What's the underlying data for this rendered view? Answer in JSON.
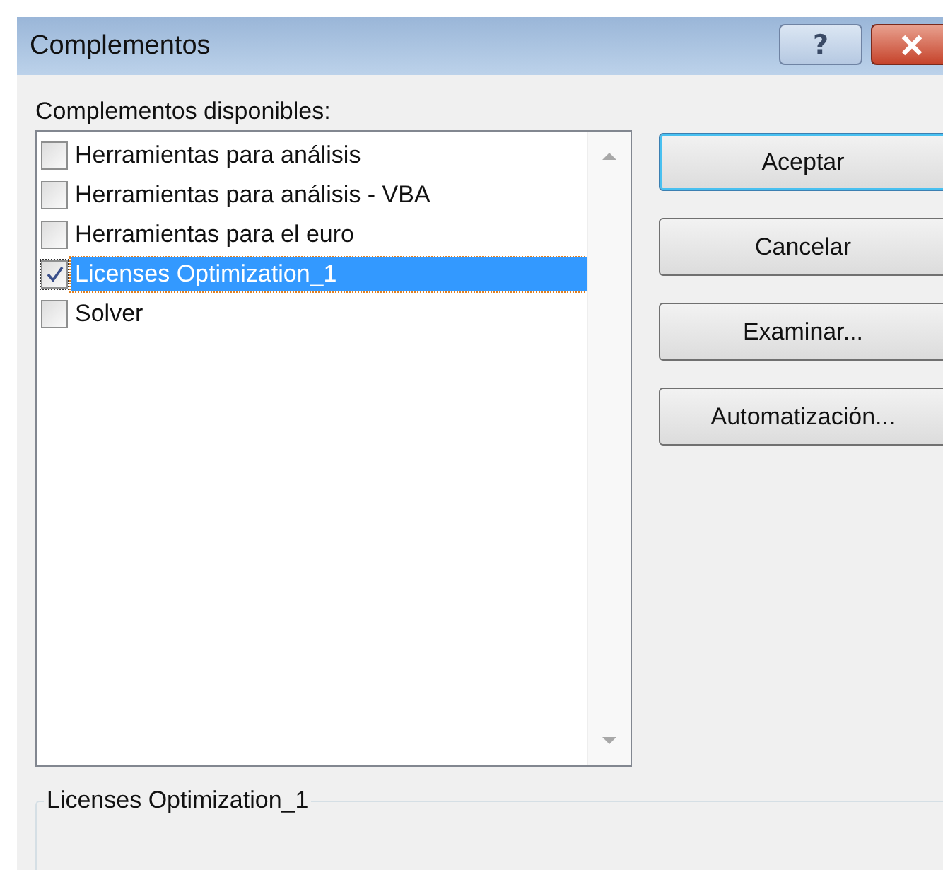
{
  "window": {
    "title": "Complementos",
    "help_button": "?"
  },
  "list_label": "Complementos disponibles:",
  "addins": [
    {
      "label": "Herramientas para análisis",
      "checked": false,
      "selected": false
    },
    {
      "label": "Herramientas para análisis - VBA",
      "checked": false,
      "selected": false
    },
    {
      "label": "Herramientas para el euro",
      "checked": false,
      "selected": false
    },
    {
      "label": "Licenses Optimization_1",
      "checked": true,
      "selected": true
    },
    {
      "label": "Solver",
      "checked": false,
      "selected": false
    }
  ],
  "buttons": [
    {
      "label": "Aceptar",
      "default": true
    },
    {
      "label": "Cancelar",
      "default": false
    },
    {
      "label": "Examinar...",
      "default": false
    },
    {
      "label": "Automatización...",
      "default": false
    }
  ],
  "details_group": {
    "title": "Licenses Optimization_1"
  }
}
